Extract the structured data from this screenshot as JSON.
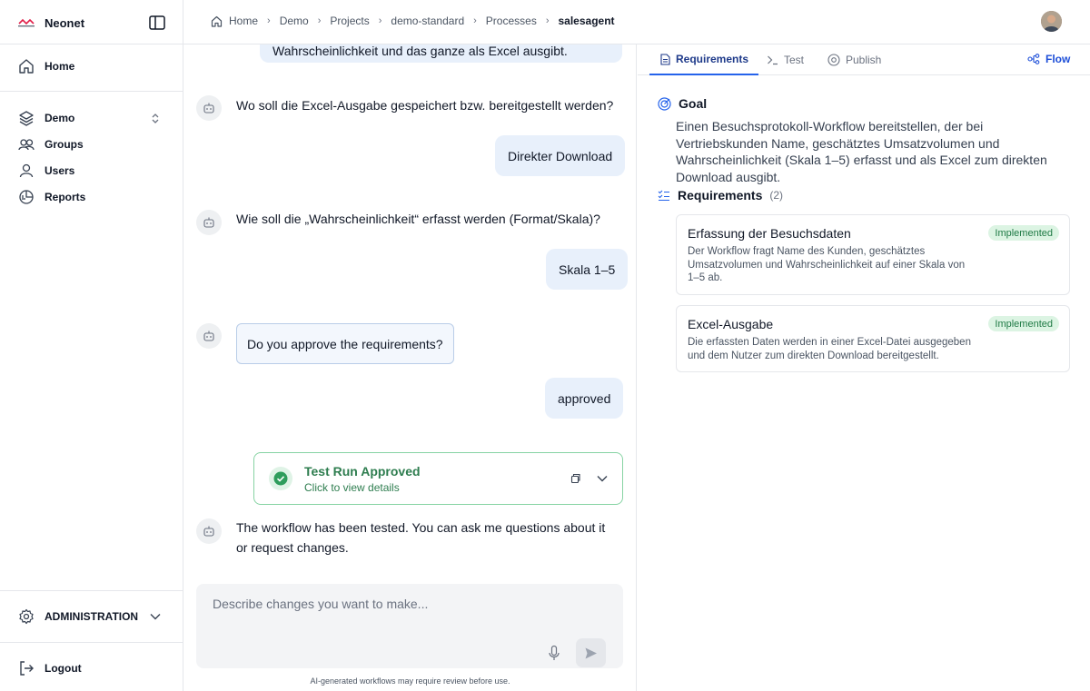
{
  "app": {
    "name": "Neonet"
  },
  "sidebar": {
    "items": [
      {
        "label": "Home",
        "icon": "home-icon"
      },
      {
        "label": "Demo",
        "icon": "layers-icon"
      },
      {
        "label": "Groups",
        "icon": "groups-icon"
      },
      {
        "label": "Users",
        "icon": "user-icon"
      },
      {
        "label": "Reports",
        "icon": "reports-icon"
      }
    ],
    "admin_label": "ADMINISTRATION",
    "logout_label": "Logout"
  },
  "breadcrumb": [
    "Home",
    "Demo",
    "Projects",
    "demo-standard",
    "Processes",
    "salesagent"
  ],
  "chat": {
    "partial_user_message": "Wahrscheinlichkeit und das ganze als Excel ausgibt.",
    "messages": [
      {
        "role": "bot",
        "text": "Wo soll die Excel-Ausgabe gespeichert bzw. bereitgestellt werden?"
      },
      {
        "role": "user",
        "text": "Direkter Download"
      },
      {
        "role": "bot",
        "text": "Wie soll die „Wahrscheinlichkeit“ erfasst werden (Format/Skala)?"
      },
      {
        "role": "user",
        "text": "Skala 1–5"
      },
      {
        "role": "bot",
        "text": "Do you approve the requirements?"
      },
      {
        "role": "user",
        "text": "approved"
      },
      {
        "role": "bot",
        "text": "The workflow has been tested. You can ask me questions about it or request changes."
      }
    ],
    "test_card": {
      "title": "Test Run Approved",
      "subtitle": "Click to view details"
    },
    "composer_placeholder": "Describe changes you want to make...",
    "disclaimer": "AI-generated workflows may require review before use."
  },
  "panel": {
    "tabs": [
      "Requirements",
      "Test",
      "Publish"
    ],
    "active_tab": "Requirements",
    "flow_label": "Flow",
    "goal_heading": "Goal",
    "goal_text": "Einen Besuchsprotokoll-Workflow bereitstellen, der bei Vertriebskunden Name, geschätztes Umsatzvolumen und Wahrscheinlichkeit (Skala 1–5) erfasst und als Excel zum direkten Download ausgibt.",
    "requirements_heading": "Requirements",
    "requirements_count": "(2)",
    "requirements": [
      {
        "title": "Erfassung der Besuchsdaten",
        "status": "Implemented",
        "description": "Der Workflow fragt Name des Kunden, geschätztes Umsatzvolumen und Wahrscheinlichkeit auf einer Skala von 1–5 ab."
      },
      {
        "title": "Excel-Ausgabe",
        "status": "Implemented",
        "description": "Die erfassten Daten werden in einer Excel-Datei ausgegeben und dem Nutzer zum direkten Download bereitgestellt."
      }
    ]
  },
  "colors": {
    "accent": "#2563eb",
    "user_bubble": "#e8f0fb",
    "success": "#2e7d4f",
    "badge_bg": "#dcf4e3"
  }
}
